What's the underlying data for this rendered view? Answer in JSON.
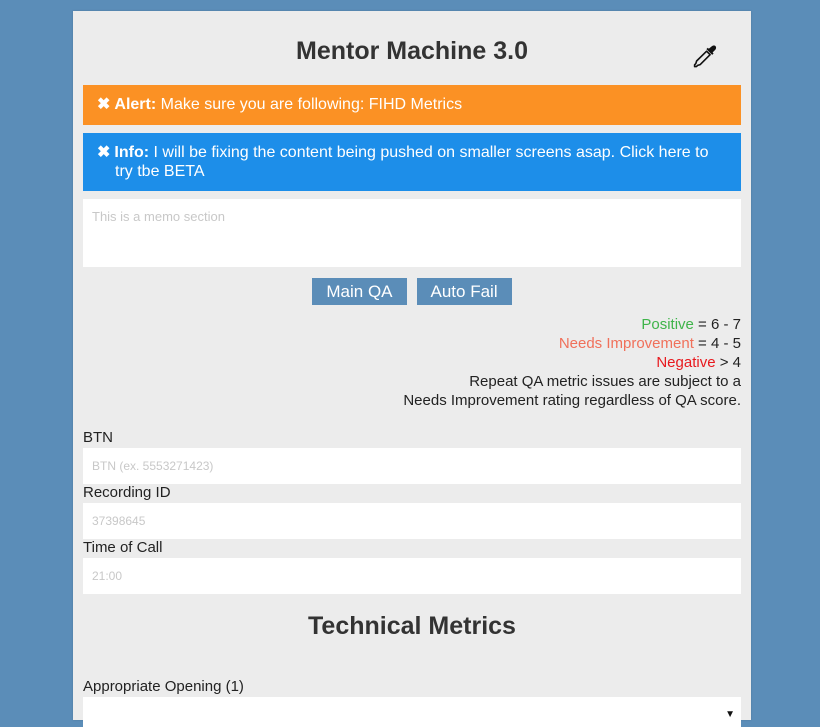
{
  "app": {
    "title": "Mentor Machine 3.0"
  },
  "alert": {
    "label": "Alert:",
    "message": "Make sure you are following:  FIHD Metrics"
  },
  "info": {
    "label": "Info:",
    "message": "I will be fixing the content being pushed on smaller screens asap. Click here to try tbe BETA"
  },
  "memo": {
    "placeholder": "This is a memo section",
    "value": ""
  },
  "tabs": [
    {
      "label": "Main QA"
    },
    {
      "label": "Auto Fail"
    }
  ],
  "legend": {
    "positive_label": "Positive",
    "positive_range": "= 6 - 7",
    "ni_label": "Needs Improvement",
    "ni_range": "= 4 - 5",
    "negative_label": "Negative",
    "negative_range": "> 4",
    "note_line1": "Repeat QA metric issues are subject to a",
    "note_line2": "Needs Improvement rating regardless of QA score."
  },
  "fields": {
    "btn": {
      "label": "BTN",
      "placeholder": "BTN (ex. 5553271423)"
    },
    "recording": {
      "label": "Recording ID",
      "placeholder": "37398645"
    },
    "time": {
      "label": "Time of Call",
      "placeholder": "21:00"
    }
  },
  "section": {
    "title": "Technical Metrics"
  },
  "metrics": [
    {
      "label": "Appropriate Opening (1)",
      "selected": ""
    }
  ],
  "colors": {
    "background": "#5b8db8",
    "alert": "#fb9124",
    "info": "#1d8ee9",
    "button": "#5b8db8",
    "positive": "#3fb44a",
    "needs_improvement": "#f0705a",
    "negative": "#e8191e"
  },
  "icons": {
    "dropper": "eyedropper-icon",
    "close": "close-icon",
    "select": "chevron-down-icon"
  }
}
